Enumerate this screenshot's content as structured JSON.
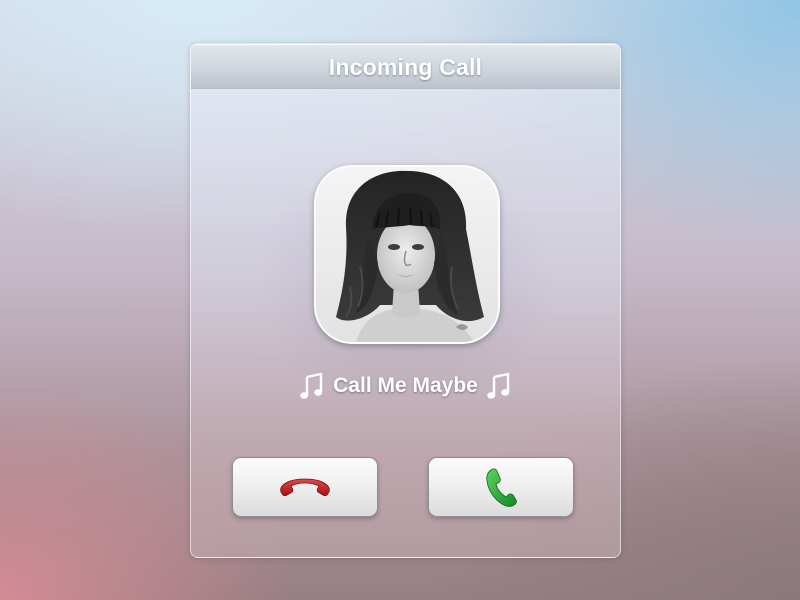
{
  "window": {
    "title": "Incoming Call"
  },
  "caller": {
    "name": "Call Me Maybe",
    "avatar_icon": "caller-photo",
    "music_icon": "music-note-icon"
  },
  "actions": {
    "decline_icon": "hang-up-icon",
    "accept_icon": "phone-answer-icon"
  },
  "colors": {
    "decline": "#c4161c",
    "accept": "#1fa22f",
    "title_text": "#ffffff"
  }
}
